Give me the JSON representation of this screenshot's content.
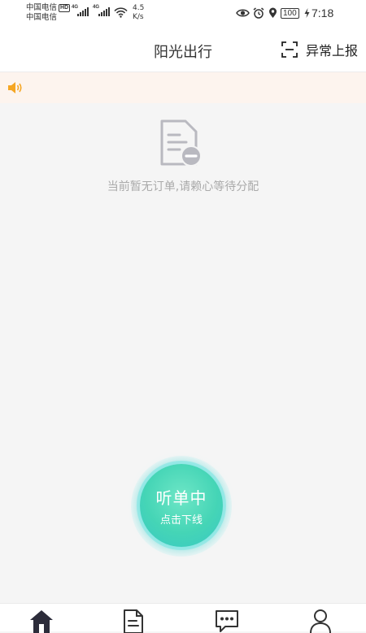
{
  "status_bar": {
    "carrier1": "中国电信",
    "carrier1_badge": "HD",
    "carrier2": "中国电信",
    "signal1_type": "4G",
    "signal2_type": "4G",
    "net_speed_value": "4.5",
    "net_speed_unit": "K/s",
    "battery": "100",
    "time": "7:18"
  },
  "header": {
    "title": "阳光出行",
    "report_label": "异常上报"
  },
  "empty_state": {
    "icon": "document-minus-icon",
    "message": "当前暂无订单,请赖心等待分配"
  },
  "listen_button": {
    "status": "听单中",
    "action": "点击下线"
  },
  "bottom_nav": {
    "items": [
      {
        "icon": "home-icon",
        "active": true
      },
      {
        "icon": "orders-icon",
        "active": false
      },
      {
        "icon": "message-icon",
        "active": false
      },
      {
        "icon": "profile-icon",
        "active": false
      }
    ]
  },
  "colors": {
    "notice_bg": "#fdf4ee",
    "speaker": "#f5a623",
    "accent_green": "#45d5b6"
  }
}
